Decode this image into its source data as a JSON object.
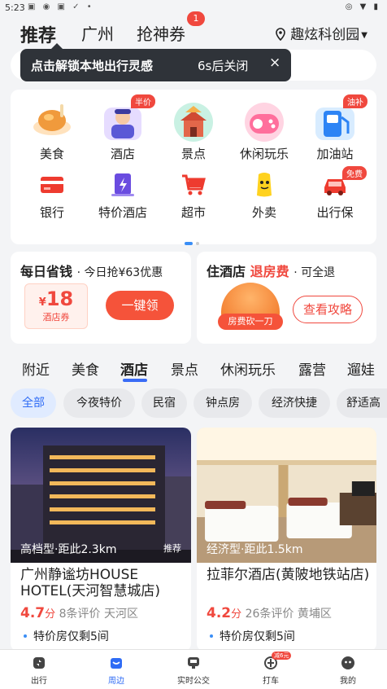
{
  "status_bar": {
    "time": "5:23"
  },
  "header": {
    "tabs": [
      {
        "label": "推荐",
        "active": true
      },
      {
        "label": "广州",
        "active": false
      },
      {
        "label": "抢神券",
        "active": false
      }
    ],
    "coupon_badge": "1",
    "location": "趣炫科创园"
  },
  "tooltip": {
    "text": "点击解锁本地出行灵感",
    "close_text": "6s后关闭",
    "close_icon": "×"
  },
  "services": [
    {
      "label": "美食",
      "icon": "food-icon"
    },
    {
      "label": "酒店",
      "icon": "hotel-icon",
      "tag": "半价"
    },
    {
      "label": "景点",
      "icon": "scenic-icon"
    },
    {
      "label": "休闲玩乐",
      "icon": "game-icon"
    },
    {
      "label": "加油站",
      "icon": "gas-station-icon",
      "tag": "油补"
    },
    {
      "label": "银行",
      "icon": "bank-card-icon"
    },
    {
      "label": "特价酒店",
      "icon": "special-hotel-icon"
    },
    {
      "label": "超市",
      "icon": "cart-icon"
    },
    {
      "label": "外卖",
      "icon": "takeout-icon"
    },
    {
      "label": "出行保",
      "icon": "car-insurance-icon",
      "tag": "免费"
    }
  ],
  "promo_left": {
    "title_a": "每日省钱",
    "subtitle": "· 今日抢¥63优惠",
    "coupon_currency": "¥",
    "coupon_amount": "18",
    "coupon_label": "酒店券",
    "button": "一键领"
  },
  "promo_right": {
    "title_a": "住酒店",
    "title_b": "退房费",
    "subtitle": "· 可全退",
    "image_label": "房费砍一刀",
    "button": "查看攻略"
  },
  "category_tabs": [
    "附近",
    "美食",
    "酒店",
    "景点",
    "休闲玩乐",
    "露营",
    "遛娃"
  ],
  "active_category": "酒店",
  "filter_chips": [
    "全部",
    "今夜特价",
    "民宿",
    "钟点房",
    "经济快捷",
    "舒适高"
  ],
  "hotels": [
    {
      "overlay": "高档型·距此2.3km",
      "recommend": "推荐",
      "name": "广州静谧坊HOUSE HOTEL(天河智慧城店)",
      "score": "4.7",
      "score_unit": "分",
      "reviews": "8条评价",
      "area": "天河区",
      "promo": "特价房仅剩5间"
    },
    {
      "overlay": "经济型·距此1.5km",
      "name": "拉菲尔酒店(黄陂地铁站店)",
      "score": "4.2",
      "score_unit": "分",
      "reviews": "26条评价",
      "area": "黄埔区",
      "promo": "特价房仅剩5间"
    }
  ],
  "bottom_nav": [
    {
      "label": "出行",
      "icon": "travel-icon"
    },
    {
      "label": "周边",
      "icon": "nearby-icon",
      "active": true
    },
    {
      "label": "实时公交",
      "icon": "bus-icon"
    },
    {
      "label": "打车",
      "icon": "taxi-icon",
      "badge": "减6元"
    },
    {
      "label": "我的",
      "icon": "profile-icon"
    }
  ],
  "colors": {
    "accent_blue": "#2f6cf5",
    "accent_red": "#f0483e",
    "background": "#f3f4f6"
  }
}
